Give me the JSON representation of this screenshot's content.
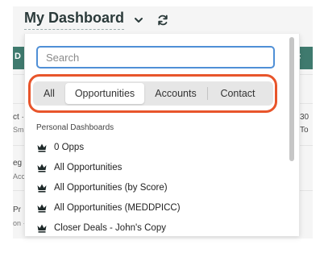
{
  "header": {
    "title": "My Dashboard",
    "band_left_text": "D",
    "band_right_text": "×"
  },
  "background_peek": [
    {
      "text": "ct ·"
    },
    {
      "text": "Sma"
    },
    {
      "text": "eg"
    },
    {
      "text": "Acc"
    },
    {
      "text": "Pr"
    },
    {
      "text": "on ·"
    },
    {
      "text": "30"
    },
    {
      "text": "To"
    }
  ],
  "dropdown": {
    "search": {
      "placeholder": "Search",
      "value": ""
    },
    "tabs": [
      {
        "label": "All"
      },
      {
        "label": "Opportunities",
        "selected": true
      },
      {
        "label": "Accounts"
      },
      {
        "label": "Contact"
      }
    ],
    "section_label": "Personal Dashboards",
    "items": [
      {
        "label": "0 Opps",
        "icon": "crown-icon"
      },
      {
        "label": "All Opportunities",
        "icon": "crown-icon"
      },
      {
        "label": "All Opportunities (by Score)",
        "icon": "crown-icon"
      },
      {
        "label": "All Opportunities (MEDDPICC)",
        "icon": "crown-icon"
      },
      {
        "label": "Closer Deals - John's Copy",
        "icon": "crown-icon"
      }
    ]
  },
  "colors": {
    "brand_green": "#3f7a6e",
    "highlight": "#e8552b",
    "focus_blue": "#4f8fd6"
  }
}
